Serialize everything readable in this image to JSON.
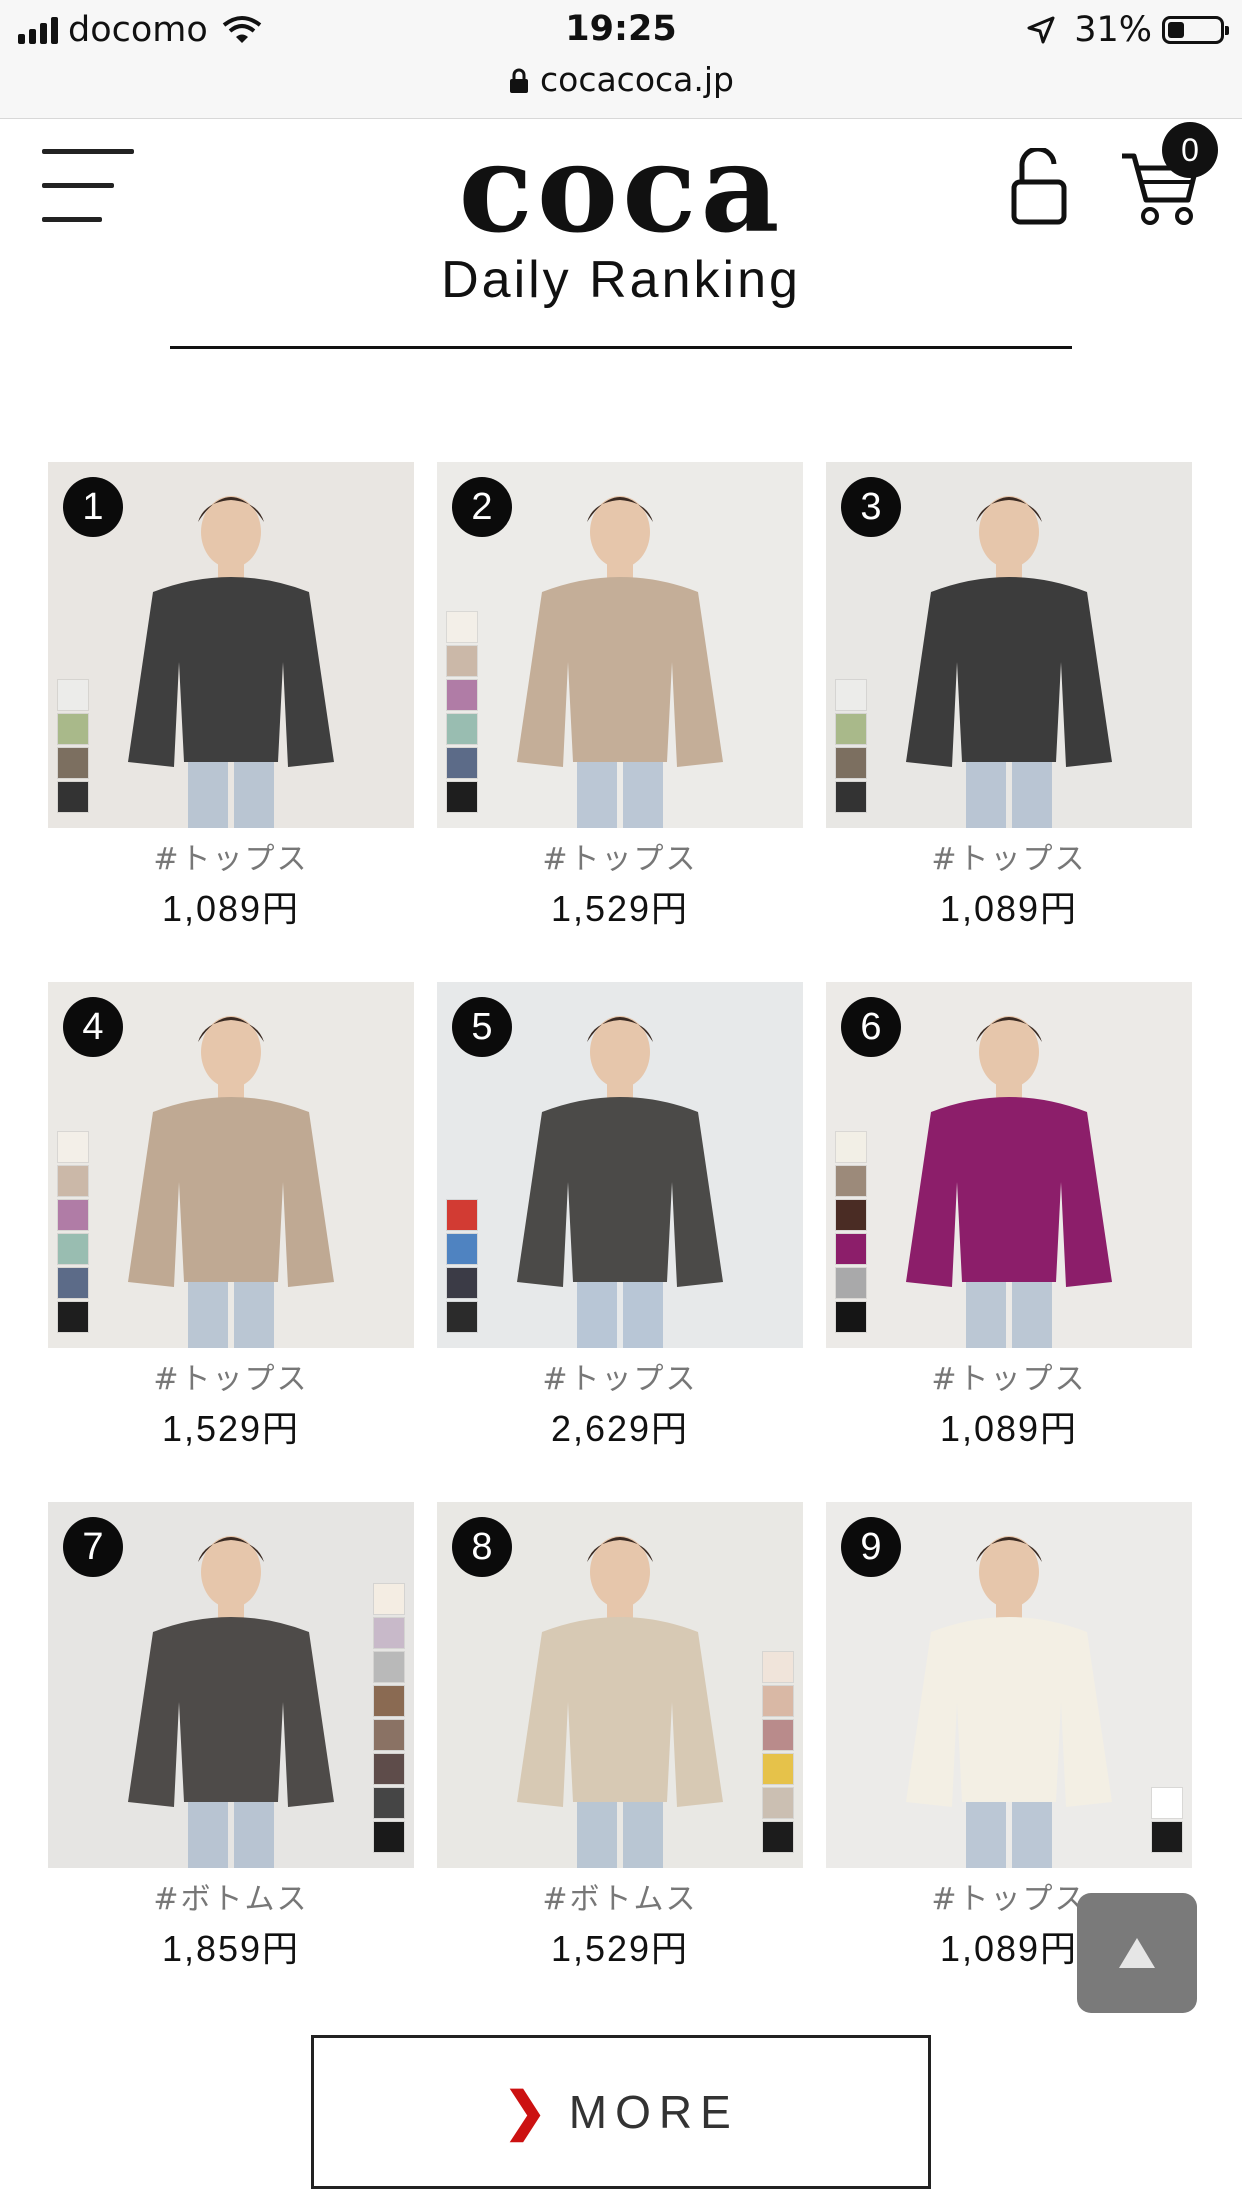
{
  "status_bar": {
    "carrier": "docomo",
    "time": "19:25",
    "url": "cocacoca.jp",
    "battery": "31%",
    "battery_level": 0.31
  },
  "header": {
    "logo": "coca",
    "title": "Daily Ranking",
    "cart_count": "0"
  },
  "products": [
    {
      "rank": "1",
      "category": "#トップス",
      "price": "1,089円",
      "bg": "#e9e6e2",
      "garment": "#3f3f3f",
      "swatches": [
        "#ececea",
        "#a9b98a",
        "#7c6f60",
        "#333333"
      ],
      "swatch_side": "left"
    },
    {
      "rank": "2",
      "category": "#トップス",
      "price": "1,529円",
      "bg": "#ecebe8",
      "garment": "#c4ae98",
      "swatches": [
        "#f3efe8",
        "#cbb8a8",
        "#b07ca6",
        "#99bdb1",
        "#5c6b88",
        "#1e1e1e"
      ],
      "swatch_side": "left"
    },
    {
      "rank": "3",
      "category": "#トップス",
      "price": "1,089円",
      "bg": "#e8e7e4",
      "garment": "#3c3c3c",
      "swatches": [
        "#ececea",
        "#a9b98a",
        "#7c6f60",
        "#333333"
      ],
      "swatch_side": "left"
    },
    {
      "rank": "4",
      "category": "#トップス",
      "price": "1,529円",
      "bg": "#ebe9e5",
      "garment": "#bfa993",
      "swatches": [
        "#f3efe8",
        "#cbb8a8",
        "#b07ca6",
        "#99bdb1",
        "#5c6b88",
        "#1e1e1e"
      ],
      "swatch_side": "left"
    },
    {
      "rank": "5",
      "category": "#トップス",
      "price": "2,629円",
      "bg": "#e7e9ea",
      "garment": "#4b4a48",
      "swatches": [
        "#d23b33",
        "#4f83c1",
        "#3b3b46",
        "#2b2b2b"
      ],
      "swatch_side": "left"
    },
    {
      "rank": "6",
      "category": "#トップス",
      "price": "1,089円",
      "bg": "#eceae7",
      "garment": "#8c1e6a",
      "swatches": [
        "#f2efe6",
        "#9c8a7a",
        "#4a2c24",
        "#8c1e6a",
        "#a9a9aa",
        "#151515"
      ],
      "swatch_side": "left"
    },
    {
      "rank": "7",
      "category": "#ボトムス",
      "price": "1,859円",
      "bg": "#e6e5e3",
      "garment": "#4e4b49",
      "swatches": [
        "#f4ede3",
        "#c8b9c9",
        "#b9b9b9",
        "#8a6a52",
        "#8a7264",
        "#5e4c4a",
        "#454545",
        "#1a1a1a"
      ],
      "swatch_side": "right"
    },
    {
      "rank": "8",
      "category": "#ボトムス",
      "price": "1,529円",
      "bg": "#e9e8e4",
      "garment": "#d7c9b4",
      "swatches": [
        "#f0e4da",
        "#d9b8a5",
        "#b98b8b",
        "#e6c24a",
        "#cbbfb2",
        "#1c1c1c"
      ],
      "swatch_side": "right"
    },
    {
      "rank": "9",
      "category": "#トップス",
      "price": "1,089円",
      "bg": "#ecebe9",
      "garment": "#f3efe4",
      "swatches": [
        "#ffffff",
        "#1b1b1b"
      ],
      "swatch_side": "right"
    }
  ],
  "more_button": {
    "label": "MORE"
  }
}
